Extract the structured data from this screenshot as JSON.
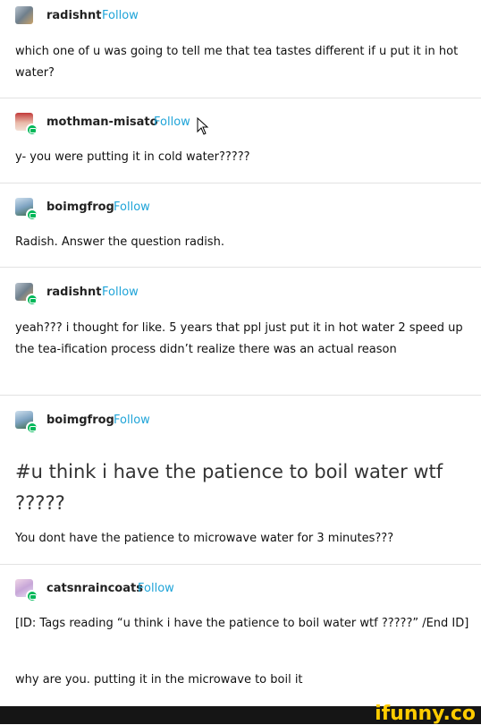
{
  "colors": {
    "follow": "#1fa4d8",
    "badge": "#00b859",
    "divider": "#e2e2e2",
    "watermark": "#ffcc00",
    "watermark_bar": "#151515"
  },
  "posts": [
    {
      "username": "radishnt",
      "follow": "Follow",
      "avatar_icon": "radish-avatar-icon",
      "text": "which one of u was going to tell me that tea tastes different if u put it in hot water?"
    },
    {
      "username": "mothman-misato",
      "follow": "Follow",
      "avatar_icon": "anime-avatar-icon",
      "text": "y- you were putting it in cold water?????"
    },
    {
      "username": "boimgfrog",
      "follow": "Follow",
      "avatar_icon": "frog-avatar-icon",
      "text": "Radish. Answer the question radish."
    },
    {
      "username": "radishnt",
      "follow": "Follow",
      "avatar_icon": "radish-avatar-icon",
      "text": "yeah??? i thought for like. 5 years that ppl just put it in hot water 2 speed up the tea-ification process didn’t realize there was an actual reason"
    },
    {
      "username": "boimgfrog",
      "follow": "Follow",
      "avatar_icon": "frog-avatar-icon",
      "tag_text": "#u think i have the patience to boil water wtf ?????",
      "text": "You dont have the patience to microwave water for 3 minutes???"
    },
    {
      "username": "catsnraincoats",
      "follow": "Follow",
      "avatar_icon": "cat-avatar-icon",
      "text": "[ID: Tags reading “u think i have the patience to boil water wtf ?????” /End ID]",
      "text2": "why are you. putting it in the microwave to boil it"
    }
  ],
  "watermark": "ifunny.co",
  "cursor_icon": "mouse-cursor-icon"
}
